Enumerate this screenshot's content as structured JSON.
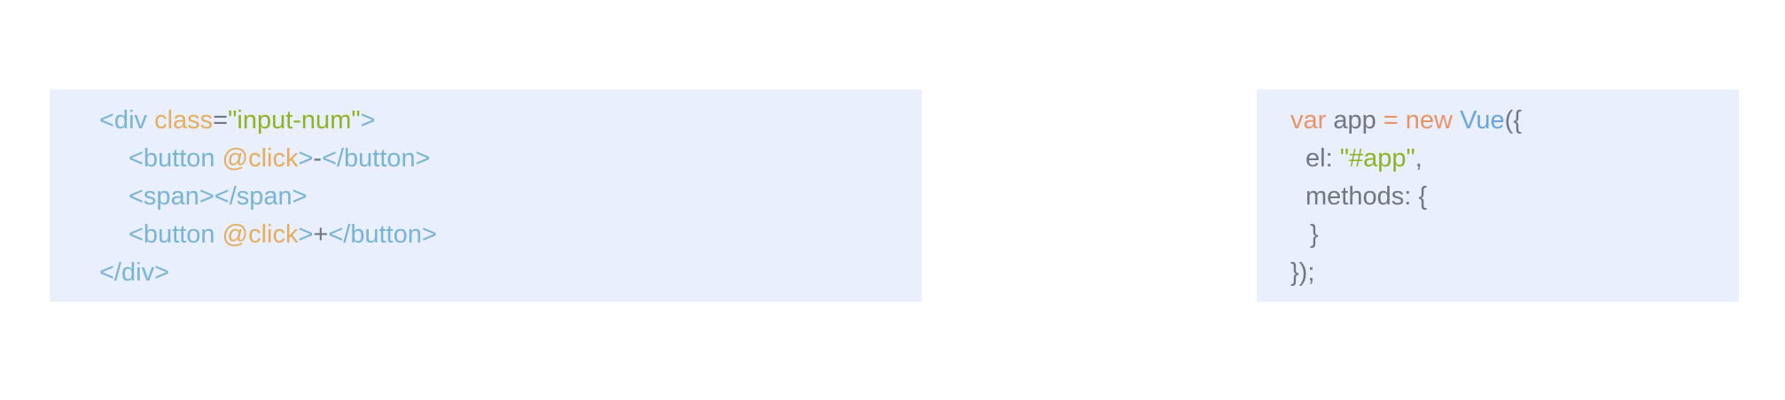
{
  "html_snippet": {
    "line1": {
      "open": "<div ",
      "attr": "class",
      "eq": "=",
      "value": "\"input-num\"",
      "close": ">"
    },
    "line2": {
      "open": "<button ",
      "attr": "@click",
      "close": ">",
      "text": "-",
      "end": "</button>"
    },
    "line3": {
      "text": "<span></span>"
    },
    "line4": {
      "open": "<button ",
      "attr": "@click",
      "close": ">",
      "text": "+",
      "end": "</button>"
    },
    "line5": {
      "text": "</div>"
    }
  },
  "js_snippet": {
    "line1": {
      "kw_var": "var",
      "name": " app ",
      "op": "=",
      "kw_new": " new ",
      "cls": "Vue",
      "rest": "({"
    },
    "line2": {
      "key": "el: ",
      "value": "\"#app\"",
      "rest": ","
    },
    "line3": {
      "text": "methods: {"
    },
    "line4": {
      "text": "}"
    },
    "line5": {
      "text": "});"
    }
  }
}
